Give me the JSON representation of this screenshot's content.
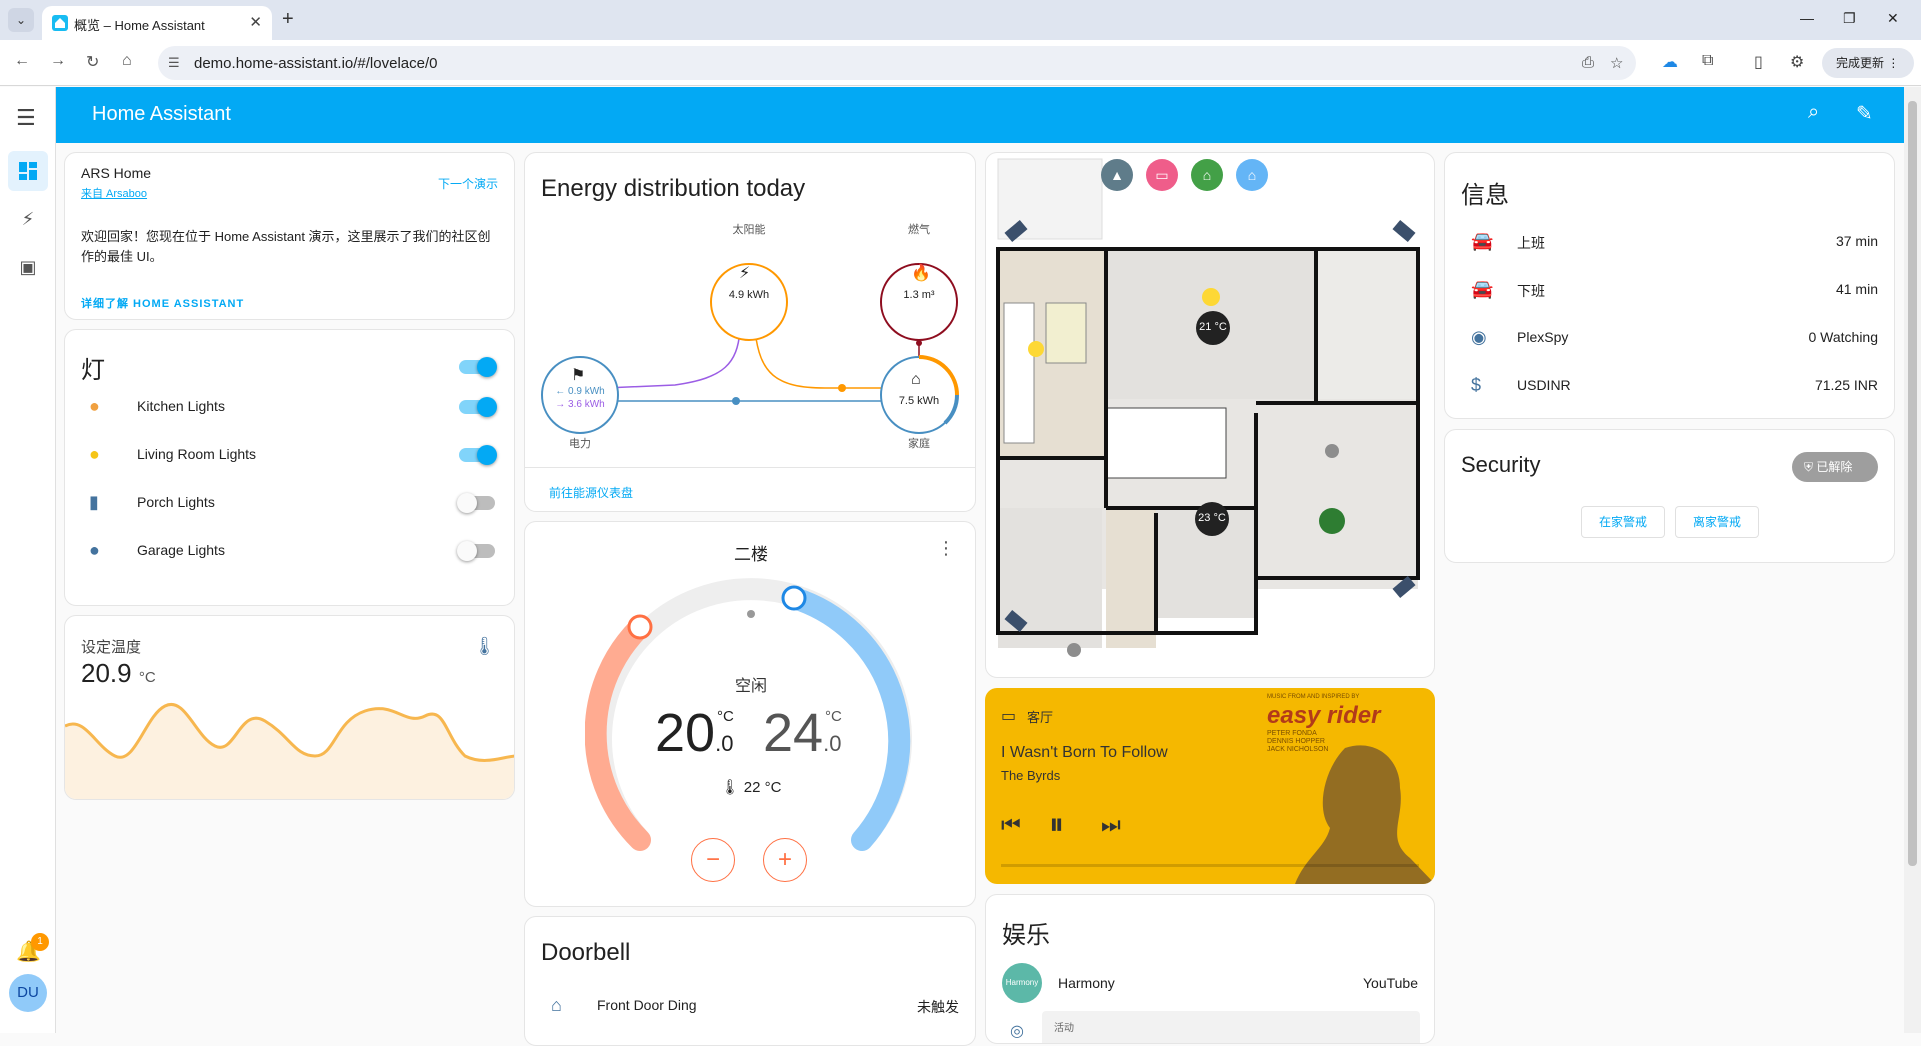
{
  "browser": {
    "tab_title": "概览 – Home Assistant",
    "url": "demo.home-assistant.io/#/lovelace/0",
    "update_label": "完成更新"
  },
  "header": {
    "title": "Home Assistant"
  },
  "sidebar": {
    "notification_count": "1",
    "user_initials": "DU"
  },
  "welcome": {
    "title": "ARS Home",
    "source": "来自 Arsaboo",
    "next_demo": "下一个演示",
    "text": "欢迎回家！您现在位于 Home Assistant 演示，这里展示了我们的社区创作的最佳 UI。",
    "learn_more": "详细了解 HOME ASSISTANT"
  },
  "lights": {
    "title": "灯",
    "items": [
      {
        "name": "Kitchen Lights",
        "state": "on",
        "color": "#f0a040"
      },
      {
        "name": "Living Room Lights",
        "state": "on",
        "color": "#f5c518"
      },
      {
        "name": "Porch Lights",
        "state": "off",
        "color": "#44739e"
      },
      {
        "name": "Garage Lights",
        "state": "off",
        "color": "#44739e"
      }
    ]
  },
  "temperature": {
    "title": "设定温度",
    "value": "20.9",
    "unit": "°C",
    "series_color": "#f7b74f"
  },
  "energy": {
    "title": "Energy distribution today",
    "solar_label": "太阳能",
    "solar_value": "4.9 kWh",
    "gas_label": "燃气",
    "gas_value": "1.3 m³",
    "grid_label": "电力",
    "grid_in": "← 0.9 kWh",
    "grid_out": "→ 3.6 kWh",
    "home_label": "家庭",
    "home_value": "7.5 kWh",
    "dashboard_link": "前往能源仪表盘"
  },
  "thermostat": {
    "title": "二楼",
    "mode": "空闲",
    "low_int": "20",
    "low_dec": ".0",
    "high_int": "24",
    "high_dec": ".0",
    "unit": "°C",
    "current": "22 °C",
    "minus": "−",
    "plus": "+"
  },
  "doorbell": {
    "title": "Doorbell",
    "item_name": "Front Door Ding",
    "item_state": "未触发"
  },
  "floorplan": {
    "temp1": "21 °C",
    "temp2": "23 °C"
  },
  "media": {
    "room": "客厅",
    "track": "I Wasn't Born To Follow",
    "artist": "The Byrds",
    "art_text": "easy rider",
    "art_small": "MUSIC FROM AND INSPIRED BY",
    "art_cast": "PETER FONDA\nDENNIS HOPPER\nJACK NICHOLSON",
    "bg_color": "#f5b800"
  },
  "entertainment": {
    "title": "娱乐",
    "harmony_label": "Harmony",
    "harmony_value": "YouTube",
    "activity_label": "活动",
    "harmony_avatar": "Harmony"
  },
  "info": {
    "title": "信息",
    "items": [
      {
        "name": "上班",
        "value": "37 min",
        "icon": "car-icon"
      },
      {
        "name": "下班",
        "value": "41 min",
        "icon": "car-icon"
      },
      {
        "name": "PlexSpy",
        "value": "0 Watching",
        "icon": "eye-icon"
      },
      {
        "name": "USDINR",
        "value": "71.25 INR",
        "icon": "dollar-icon"
      }
    ]
  },
  "security": {
    "title": "Security",
    "state": "已解除",
    "arm_home": "在家警戒",
    "arm_away": "离家警戒"
  }
}
